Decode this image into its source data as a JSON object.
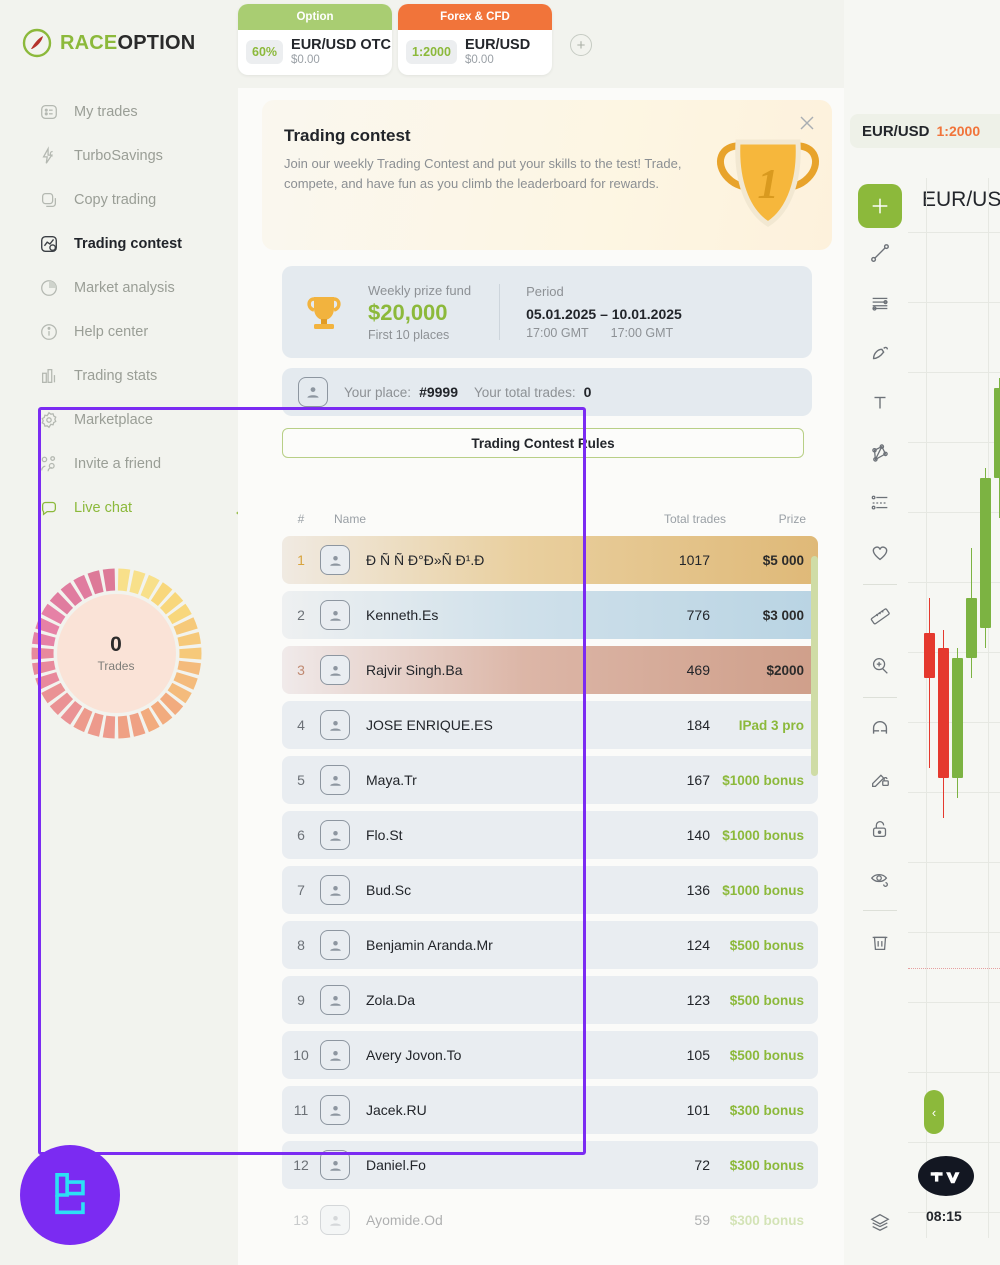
{
  "brand": {
    "part1": "RACE",
    "part2": "OPTION",
    "logo_icon": "raceoption-logo-icon"
  },
  "sidebar": {
    "items": [
      {
        "label": "My trades",
        "icon": "list-card-icon",
        "state": "normal"
      },
      {
        "label": "TurboSavings",
        "icon": "turbo-bolt-icon",
        "state": "normal"
      },
      {
        "label": "Copy trading",
        "icon": "copy-icon",
        "state": "normal"
      },
      {
        "label": "Trading contest",
        "icon": "contest-star-icon",
        "state": "active"
      },
      {
        "label": "Market analysis",
        "icon": "pie-chart-icon",
        "state": "normal"
      },
      {
        "label": "Help center",
        "icon": "info-circle-icon",
        "state": "normal"
      },
      {
        "label": "Trading stats",
        "icon": "bar-chart-icon",
        "state": "normal"
      },
      {
        "label": "Marketplace",
        "icon": "gear-badge-icon",
        "state": "normal"
      },
      {
        "label": "Invite a friend",
        "icon": "people-icon",
        "state": "normal"
      },
      {
        "label": "Live chat",
        "icon": "chat-bubble-icon",
        "state": "accent"
      }
    ],
    "donut": {
      "value": "0",
      "label": "Trades"
    },
    "collapse_arrow_icon": "collapse-left-arrow-icon",
    "logo_badge_icon": "purple-c-logo-icon"
  },
  "asset_tabs": {
    "add_label": "+",
    "add_icon": "plus-circle-icon",
    "tabs": [
      {
        "caption": "Option",
        "pill": "60%",
        "symbol": "EUR/USD OTC",
        "amount": "$0.00",
        "caption_color": "#a9cd72"
      },
      {
        "caption": "Forex & CFD",
        "pill": "1:2000",
        "symbol": "EUR/USD",
        "amount": "$0.00",
        "caption_color": "#f1743a"
      }
    ]
  },
  "contest": {
    "title": "Trading contest",
    "description": "Join our weekly Trading Contest and put your skills to the test! Trade, compete, and have fun as you climb the leaderboard for rewards.",
    "close_icon": "close-icon",
    "trophy_icon": "trophy-1st-place-icon",
    "prize": {
      "icon": "trophy-icon",
      "label": "Weekly prize fund",
      "amount": "$20,000",
      "sub": "First 10 places"
    },
    "period": {
      "label": "Period",
      "start_date": "05.01.2025",
      "dash": "–",
      "end_date": "10.01.2025",
      "start_time": "17:00 GMT",
      "end_time": "17:00 GMT"
    },
    "your_stats": {
      "avatar_icon": "user-avatar-icon",
      "place_label": "Your place:",
      "place_value": "#9999",
      "trades_label": "Your total trades:",
      "trades_value": "0"
    },
    "rules_button": "Trading Contest Rules"
  },
  "leaderboard": {
    "columns": {
      "rank": "#",
      "name": "Name",
      "trades": "Total trades",
      "prize": "Prize"
    },
    "rows": [
      {
        "rank": "1",
        "name": "Ð Ñ Ñ Ð°Ð»Ñ Ð¹.Ð",
        "trades": "1017",
        "prize": "$5 000",
        "style": "gold"
      },
      {
        "rank": "2",
        "name": "Kenneth.Es",
        "trades": "776",
        "prize": "$3 000",
        "style": "silver"
      },
      {
        "rank": "3",
        "name": "Rajvir Singh.Ba",
        "trades": "469",
        "prize": "$2000",
        "style": "bronze"
      },
      {
        "rank": "4",
        "name": "JOSE ENRIQUE.ES",
        "trades": "184",
        "prize": "IPad 3 pro",
        "style": "plain"
      },
      {
        "rank": "5",
        "name": "Maya.Tr",
        "trades": "167",
        "prize": "$1000 bonus",
        "style": "plain"
      },
      {
        "rank": "6",
        "name": "Flo.St",
        "trades": "140",
        "prize": "$1000 bonus",
        "style": "plain"
      },
      {
        "rank": "7",
        "name": "Bud.Sc",
        "trades": "136",
        "prize": "$1000 bonus",
        "style": "plain"
      },
      {
        "rank": "8",
        "name": "Benjamin Aranda.Mr",
        "trades": "124",
        "prize": "$500 bonus",
        "style": "plain"
      },
      {
        "rank": "9",
        "name": "Zola.Da",
        "trades": "123",
        "prize": "$500 bonus",
        "style": "plain"
      },
      {
        "rank": "10",
        "name": "Avery Jovon.To",
        "trades": "105",
        "prize": "$500 bonus",
        "style": "plain"
      },
      {
        "rank": "11",
        "name": "Jacek.RU",
        "trades": "101",
        "prize": "$300 bonus",
        "style": "plain"
      },
      {
        "rank": "12",
        "name": "Daniel.Fo",
        "trades": "72",
        "prize": "$300 bonus",
        "style": "plain"
      },
      {
        "rank": "13",
        "name": "Ayomide.Od",
        "trades": "59",
        "prize": "$300 bonus",
        "style": "fade"
      }
    ]
  },
  "chart": {
    "symbol_chip": {
      "symbol": "EUR/USD",
      "leverage": "1:2000"
    },
    "title": "EUR/USD",
    "clock": "08:15",
    "collapse_icon": "chevron-left-icon",
    "tv_badge_icon": "tradingview-icon",
    "tools": [
      {
        "name": "crosshair-icon",
        "active": true
      },
      {
        "name": "trend-line-icon",
        "active": false
      },
      {
        "name": "horizontal-lines-icon",
        "active": false
      },
      {
        "name": "brush-icon",
        "active": false
      },
      {
        "name": "text-tool-icon",
        "active": false
      },
      {
        "name": "pattern-icon",
        "active": false
      },
      {
        "name": "forecast-icon",
        "active": false
      },
      {
        "name": "heart-icon",
        "active": false
      },
      {
        "name": "ruler-icon",
        "active": false
      },
      {
        "name": "zoom-in-icon",
        "active": false
      },
      {
        "name": "magnet-icon",
        "active": false
      },
      {
        "name": "pencil-lock-icon",
        "active": false
      },
      {
        "name": "lock-icon",
        "active": false
      },
      {
        "name": "eye-hide-icon",
        "active": false
      },
      {
        "name": "trash-icon",
        "active": false
      },
      {
        "name": "layers-icon",
        "active": false
      }
    ]
  },
  "colors": {
    "accent_green": "#8cb93b",
    "orange": "#f1743a",
    "highlight_purple": "#7b2bf2",
    "panel_bg": "#fbfbf9"
  }
}
